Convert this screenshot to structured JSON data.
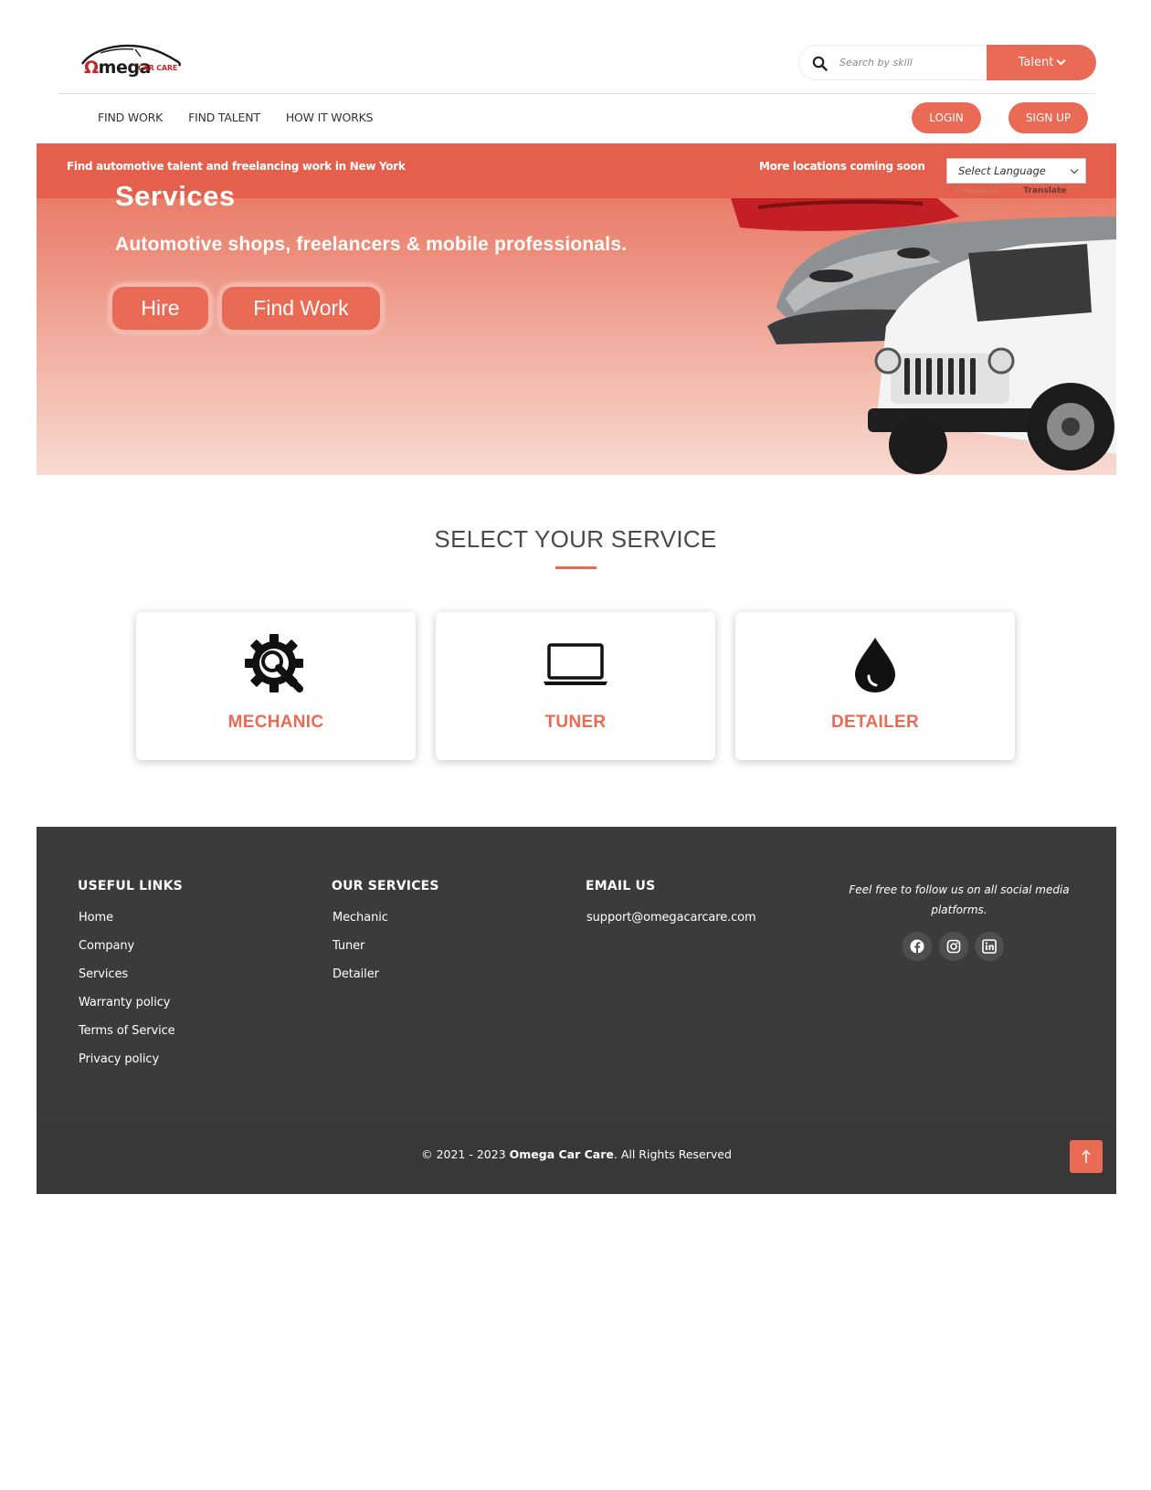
{
  "brand": {
    "logo_main": "mega",
    "logo_omega_glyph": "Ω",
    "logo_sub": "CAR CARE"
  },
  "search": {
    "placeholder": "Search by skill",
    "category_label": "Talent"
  },
  "nav": {
    "items": [
      "FIND WORK",
      "FIND TALENT",
      "HOW IT WORKS"
    ],
    "login_label": "LOGIN",
    "signup_label": "SIGN UP"
  },
  "hero": {
    "promo_left": "Find automotive talent and freelancing work in New York",
    "promo_right": "More locations coming soon",
    "language_select": "Select Language",
    "powered_by": "Powered by",
    "translate_label": "Translate",
    "title_partial": "Services",
    "subtitle": "Automotive shops, freelancers & mobile professionals.",
    "hire_label": "Hire",
    "find_work_label": "Find Work"
  },
  "services": {
    "title": "SELECT YOUR SERVICE",
    "cards": [
      {
        "label": "MECHANIC",
        "icon": "gear-wrench-icon"
      },
      {
        "label": "TUNER",
        "icon": "laptop-icon"
      },
      {
        "label": "DETAILER",
        "icon": "water-drop-icon"
      }
    ]
  },
  "footer": {
    "useful_links_title": "USEFUL LINKS",
    "useful_links": [
      "Home",
      "Company",
      "Services",
      "Warranty policy",
      "Terms of Service",
      "Privacy policy"
    ],
    "our_services_title": "OUR SERVICES",
    "our_services": [
      "Mechanic",
      "Tuner",
      "Detailer"
    ],
    "email_title": "EMAIL US",
    "email": "support@omegacarcare.com",
    "social_text": "Feel free to follow us on all social media platforms.",
    "social_icons": [
      "facebook-icon",
      "instagram-icon",
      "linkedin-icon"
    ],
    "copyright_prefix": "© 2021 - 2023",
    "copyright_brand": "Omega Car Care",
    "copyright_suffix": ". All Rights Reserved"
  },
  "colors": {
    "accent": "#e96a55",
    "footer_bg": "#3b3b3c",
    "heading": "#4a4a4a"
  }
}
